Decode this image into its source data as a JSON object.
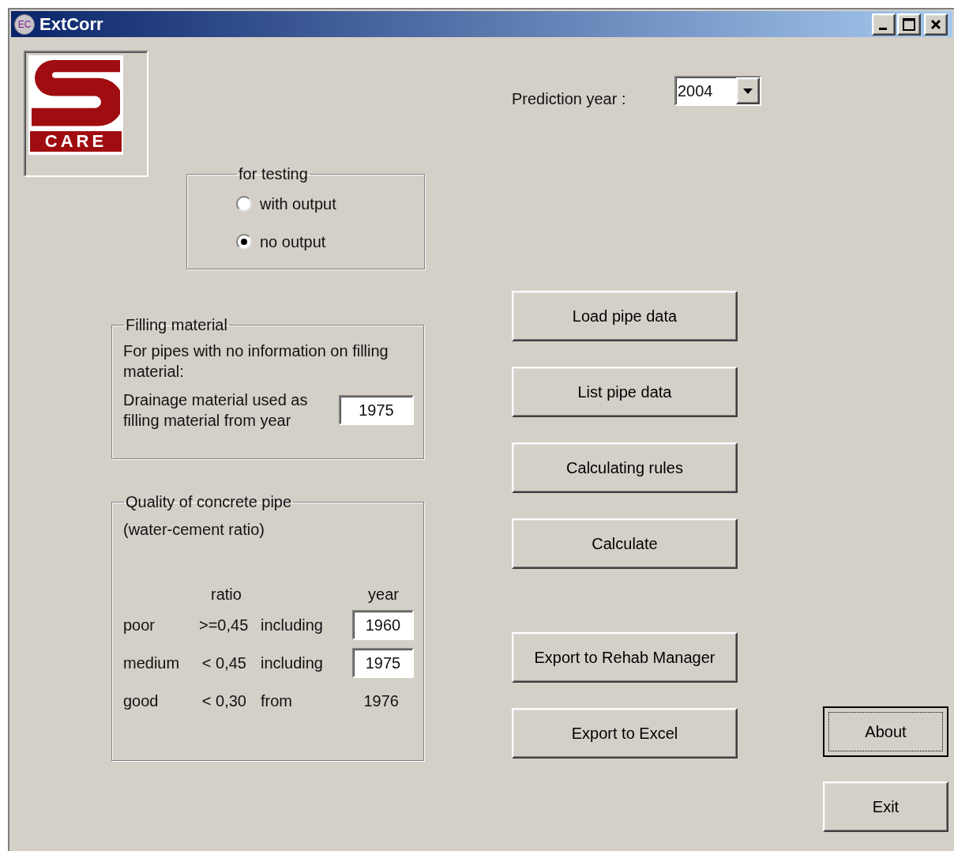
{
  "window": {
    "title": "ExtCorr",
    "icon_text": "EC"
  },
  "logo": {
    "text": "CARE"
  },
  "prediction": {
    "label": "Prediction year :",
    "value": "2004"
  },
  "testing": {
    "title": "for testing",
    "options": [
      {
        "label": "with output",
        "selected": false
      },
      {
        "label": "no output",
        "selected": true
      }
    ]
  },
  "filling": {
    "title": "Filling material",
    "note": "For pipes with no information on filling material:",
    "label": "Drainage material used as filling material from year",
    "value": "1975"
  },
  "quality": {
    "title": "Quality of concrete pipe",
    "subtitle": "(water-cement ratio)",
    "columns": [
      "ratio",
      "year"
    ],
    "rows": [
      {
        "grade": "poor",
        "ratio": ">=0,45",
        "relation": "including",
        "year": "1960",
        "kind": "input"
      },
      {
        "grade": "medium",
        "ratio": "< 0,45",
        "relation": "including",
        "year": "1975",
        "kind": "input"
      },
      {
        "grade": "good",
        "ratio": "< 0,30",
        "relation": "from",
        "year": "1976",
        "kind": "text"
      }
    ]
  },
  "data_actions": [
    "Load pipe data",
    "List pipe data",
    "Calculating rules",
    "Calculate"
  ],
  "export_actions": [
    "Export to Rehab Manager",
    "Export to Excel"
  ],
  "side_buttons": [
    {
      "label": "About",
      "focused": true
    },
    {
      "label": "Exit",
      "focused": false
    }
  ]
}
